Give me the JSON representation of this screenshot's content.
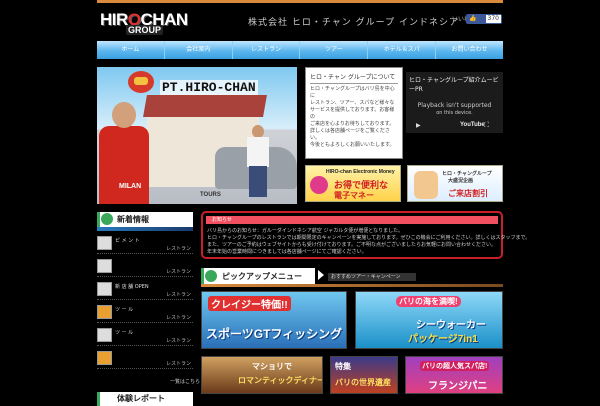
{
  "logo": {
    "line1_a": "HIR",
    "line1_o": "O",
    "line1_b": "CHAN",
    "line2": "GROUP"
  },
  "tagline": "株式会社 ヒロ・チャン グループ インドネシア",
  "facebook": {
    "label": "いいね！",
    "button": "いいね！",
    "count": "370"
  },
  "nav": [
    "ホーム",
    "会社案内",
    "レストラン",
    "ツアー",
    "ホテル＆スパ",
    "お問い合わせ"
  ],
  "hero": {
    "title": "PT.HIRO-CHAN",
    "shirt": "MILAN",
    "building": "TOURS"
  },
  "info": {
    "title": "ヒロ・チャン グループについて",
    "body": [
      "ヒロ・チャングループはバリ島を中心に",
      "レストラン、ツアー、スパなど様々な",
      "サービスを提供しております。お客様の",
      "ご来店を心よりお待ちしております。",
      "詳しくは各店舗ページをご覧ください。",
      "今後ともよろしくお願いいたします。"
    ]
  },
  "video": {
    "title": "ヒロ・チャングループ紹介ムービーPR",
    "msg1": "Playback isn't supported",
    "msg2": "on this device.",
    "yt": "YouTube"
  },
  "banner_money": {
    "a": "HIRO-chan Electronic Money",
    "b": "お得で便利な",
    "c": "電子マネー"
  },
  "banner_shop": {
    "a": "ヒロ・チャングループ",
    "b": "大盛況企画",
    "c": "ご来店割引"
  },
  "news": {
    "title": "新着情報",
    "items": [
      {
        "text": "ピ メ ン ト",
        "tag": "レストラン"
      },
      {
        "text": "",
        "tag": "レストラン"
      },
      {
        "text": "新 店 舗 OPEN",
        "tag": "レストラン"
      },
      {
        "text": "ツ ー ル",
        "tag": "レストラン"
      },
      {
        "text": "ツ ー ル",
        "tag": "レストラン"
      },
      {
        "text": "",
        "tag": "レストラン"
      }
    ],
    "more": "一覧はこちら >>"
  },
  "report_title": "体験レポート",
  "notice": {
    "title": "お知らせ",
    "lines": [
      "バリ島からのお知らせ：ガルーダインドネシア航空 ジャカルタ便が増便となりました。",
      "ヒロ・チャングループのレストランでは期間限定のキャンペーンを実施しております。ぜひこの機会にご利用ください。詳しくはスタッフまで。",
      "また、ツアーのご予約はウェブサイトからも受け付けております。ご不明な点がございましたらお気軽にお問い合わせください。",
      "年末年始の営業時間につきましては各店舗ページにてご確認ください。"
    ]
  },
  "pickup": {
    "title": "ピックアップメニュー",
    "tag": "おすすめツアー・キャンペーン"
  },
  "promos": [
    {
      "a": "クレイジー特価!!",
      "b": "スポーツGTフィッシング"
    },
    {
      "a": "バリの海を満喫!",
      "b": "シーウォーカー",
      "c": "パッケージ7in1"
    },
    {
      "a": "マショリで",
      "b": "ロマンティックディナー"
    },
    {
      "a": "特集",
      "b": "バリの世界遺産"
    },
    {
      "a": "バリの超人気スパ店!",
      "b": "フランジパニ"
    }
  ],
  "colors": {
    "nav": "#5cb6ee",
    "accent": "#d98a3c",
    "notice": "#c82028",
    "green": "#3aa85a"
  }
}
